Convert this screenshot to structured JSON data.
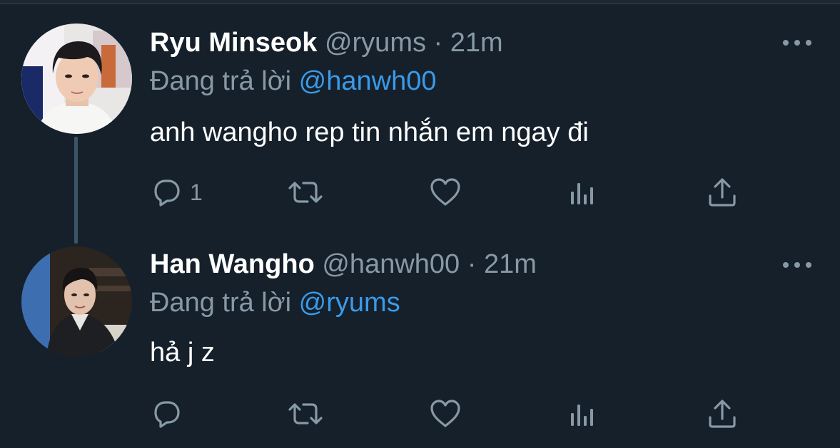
{
  "colors": {
    "background": "#15202b",
    "secondary_text": "#8899a6",
    "link": "#3a9ae8",
    "thread_line": "#3d5466"
  },
  "tweets": [
    {
      "display_name": "Ryu Minseok",
      "handle": "@ryums",
      "separator": "·",
      "time": "21m",
      "reply_label": "Đang trả lời",
      "reply_to": "@hanwh00",
      "text": "anh wangho rep tin nhắn em ngay đi",
      "reply_count": "1",
      "avatar_icon": "profile-photo"
    },
    {
      "display_name": "Han Wangho",
      "handle": "@hanwh00",
      "separator": "·",
      "time": "21m",
      "reply_label": "Đang trả lời",
      "reply_to": "@ryums",
      "text": "hả j z",
      "reply_count": "",
      "avatar_icon": "profile-photo"
    }
  ],
  "icons": {
    "more": "more-horizontal-icon",
    "reply": "reply-bubble-icon",
    "retweet": "retweet-icon",
    "like": "heart-icon",
    "analytics": "analytics-icon",
    "share": "share-icon"
  }
}
